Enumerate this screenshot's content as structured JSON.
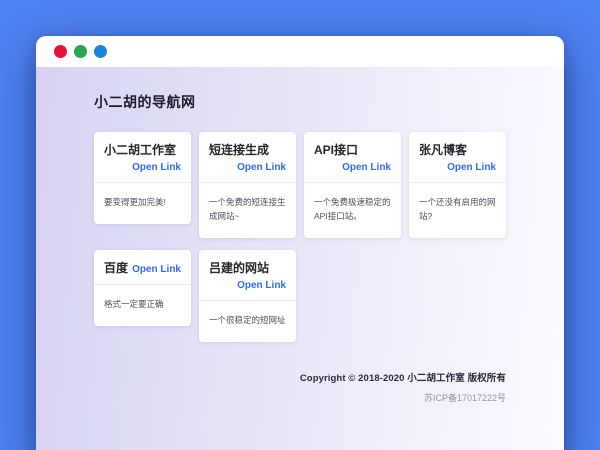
{
  "window": {
    "dots": [
      {
        "name": "red",
        "color": "#e5123a"
      },
      {
        "name": "green",
        "color": "#2ca64b"
      },
      {
        "name": "blue",
        "color": "#1d86da"
      }
    ]
  },
  "page": {
    "title": "小二胡的导航网"
  },
  "cards": [
    {
      "title": "小二胡工作室",
      "link": "Open Link",
      "desc": "要变得更加完美!"
    },
    {
      "title": "短连接生成",
      "link": "Open Link",
      "desc": "一个免费的短连接生成网站~"
    },
    {
      "title": "API接口",
      "link": "Open Link",
      "desc": "一个免费极速稳定的API接口站。"
    },
    {
      "title": "张凡博客",
      "link": "Open Link",
      "desc": "一个还没有启用的网站?"
    },
    {
      "title": "百度",
      "link": "Open Link",
      "desc": "格式一定要正确"
    },
    {
      "title": "吕建的网站",
      "link": "Open Link",
      "desc": "一个很稳定的短网址"
    }
  ],
  "footer": {
    "copyright": "Copyright © 2018-2020 小二胡工作室 版权所有",
    "icp": "苏ICP备17017222号"
  },
  "colors": {
    "desktop": "#4e82f0",
    "link": "#2e6cf0",
    "bg_start": "#d5d3f2",
    "bg_end": "#fbfbff"
  }
}
